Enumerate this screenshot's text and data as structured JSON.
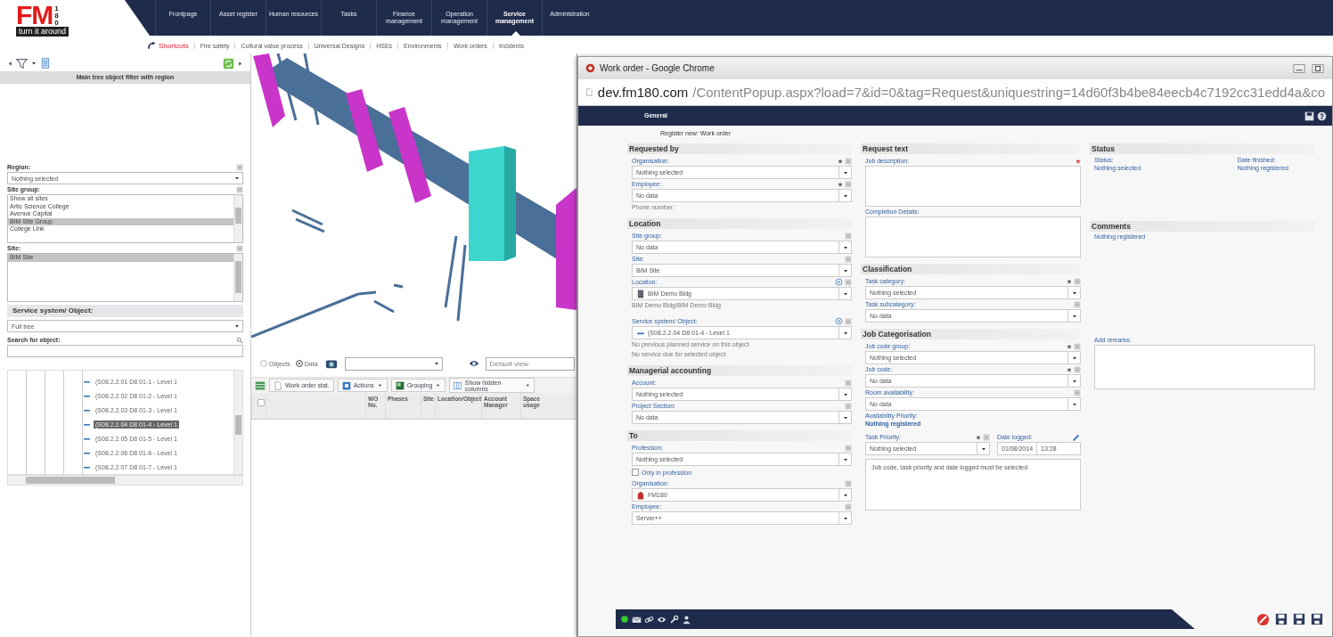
{
  "header": {
    "logo": {
      "letters": "FM",
      "number": "180",
      "tagline": "turn it around"
    },
    "nav": [
      {
        "label": "Frontpage",
        "selected": false
      },
      {
        "label": "Asset register",
        "selected": false
      },
      {
        "label": "Human resources",
        "selected": false
      },
      {
        "label": "Tasks",
        "selected": false
      },
      {
        "label": "Finance management",
        "selected": false
      },
      {
        "label": "Operation management",
        "selected": false
      },
      {
        "label": "Service management",
        "selected": true
      },
      {
        "label": "Administration",
        "selected": false
      }
    ]
  },
  "shortcuts": {
    "label": "Shortcuts",
    "items": [
      "Fire safety",
      "Cultural value process",
      "Universal Designs",
      "HSEs",
      "Environments",
      "Work orders",
      "Incidents"
    ]
  },
  "left_panel": {
    "title": "Main tree object filter with region",
    "filters": [
      {
        "kind": "select",
        "label": "Region:",
        "value": "Nothing selected"
      },
      {
        "kind": "list",
        "label": "Site group:",
        "options": [
          {
            "label": "Show all sites",
            "selected": false
          },
          {
            "label": "Artic Science College",
            "selected": false
          },
          {
            "label": "Avenue Capital",
            "selected": false
          },
          {
            "label": "BIM Site Group",
            "selected": true
          },
          {
            "label": "College Link",
            "selected": false
          }
        ]
      },
      {
        "kind": "list",
        "label": "Site:",
        "options": [
          {
            "label": "BIM Site",
            "selected": true
          }
        ]
      }
    ],
    "object_section": {
      "title": "Service system/ Object:",
      "value": "Full tree",
      "search_label": "Search for object:"
    },
    "tree": [
      {
        "label": "(S08.2.2.01 D8 01-1 - Level 1",
        "selected": false
      },
      {
        "label": "(S08.2.2.02 D8 01-2 - Level 1",
        "selected": false
      },
      {
        "label": "(S08.2.2.03 D8 01-3 - Level 1",
        "selected": false
      },
      {
        "label": "(S08.2.2.04 D8 01-4 - Level 1",
        "selected": true
      },
      {
        "label": "(S08.2.2.05 D8 01-5 - Level 1",
        "selected": false
      },
      {
        "label": "(S08.2.2.06 D8 01-6 - Level 1",
        "selected": false
      },
      {
        "label": "(S08.2.2.07 D8 01-7 - Level 1",
        "selected": false
      }
    ]
  },
  "view": {
    "kind": "picture",
    "modes": [
      {
        "label": "Objects",
        "selected": false
      },
      {
        "label": "Data",
        "selected": true
      }
    ],
    "view_name": "Default view"
  },
  "grid": {
    "toolbar": [
      {
        "kind": "plain",
        "label": "Work order stat."
      },
      {
        "kind": "menu",
        "label": "Actions"
      },
      {
        "kind": "menu",
        "label": "Grouping"
      },
      {
        "kind": "menu",
        "label": "Show hidden columns"
      }
    ],
    "all_checked": false,
    "columns": [
      "",
      "WO No.",
      "Phases",
      "Site",
      "Location/Object",
      "Account Manager",
      "Space usage"
    ]
  },
  "popup": {
    "title": "Work order - Google Chrome",
    "url_host": "dev.fm180.com",
    "url_path": "/ContentPopup.aspx?load=7&id=0&tag=Request&uniquestring=14d60f3b4be84eecb4c7192cc31edd4a&co",
    "tab": "General",
    "heading": "Register new: Work order",
    "columns": [
      [
        {
          "title": "Requested by",
          "fields": [
            {
              "kind": "select",
              "label": "Organisation:",
              "value": "Nothing selected",
              "required": true
            },
            {
              "kind": "select",
              "label": "Employee:",
              "value": "No data",
              "required": true
            },
            {
              "kind": "note",
              "text": "Phone number:"
            }
          ]
        },
        {
          "title": "Location",
          "fields": [
            {
              "kind": "select",
              "label": "Site group:",
              "value": "No data",
              "required": false
            },
            {
              "kind": "select",
              "label": "Site:",
              "value": "BIM Site",
              "required": false
            },
            {
              "kind": "select",
              "label": "Location:",
              "value": "BIM Demo Bldg",
              "required": false,
              "locate": true
            },
            {
              "kind": "note",
              "text": "BIM Demo Bldg/BIM Demo Bldg"
            }
          ]
        },
        {
          "fields": [
            {
              "kind": "select",
              "label": "Service system/ Object:",
              "value": "(S08.2.2.04 D8 01-4 - Level 1",
              "required": false,
              "locate": true
            },
            {
              "kind": "note",
              "text": "No previous planned service on this object"
            },
            {
              "kind": "note",
              "text": "No service due for selected object"
            }
          ]
        },
        {
          "title": "Managerial accounting",
          "fields": [
            {
              "kind": "select",
              "label": "Account:",
              "value": "Nothing selected",
              "required": false
            },
            {
              "kind": "select",
              "label": "Project Section:",
              "value": "No data",
              "required": false
            }
          ]
        },
        {
          "title": "To",
          "fields": [
            {
              "kind": "select",
              "label": "Profession:",
              "value": "Nothing selected",
              "required": false
            },
            {
              "kind": "checkbox",
              "label": "Only in profession",
              "checked": false
            },
            {
              "kind": "select",
              "label": "Organisation:",
              "value": "FM180",
              "required": false
            },
            {
              "kind": "select",
              "label": "Employee:",
              "value": "Server++",
              "required": false
            }
          ]
        }
      ],
      [
        {
          "title": "Request text",
          "fields": [
            {
              "kind": "textarea",
              "label": "Job description:",
              "required": true
            },
            {
              "kind": "textarea",
              "label": "Completion Details:",
              "required": false
            }
          ]
        },
        {
          "title": "Classification",
          "fields": [
            {
              "kind": "select",
              "label": "Task category:",
              "value": "Nothing selected",
              "required": true
            },
            {
              "kind": "select",
              "label": "Task subcategory:",
              "value": "No data",
              "required": false
            }
          ]
        },
        {
          "title": "Job Categorisation",
          "fields": [
            {
              "kind": "select",
              "label": "Job code group:",
              "value": "Nothing selected",
              "required": true
            },
            {
              "kind": "select",
              "label": "Job code:",
              "value": "No data",
              "required": true
            },
            {
              "kind": "select",
              "label": "Room availability:",
              "value": "No data",
              "required": false
            },
            {
              "kind": "info",
              "label": "Availability Priority:",
              "value": "Nothing registered"
            },
            {
              "kind": "priority_date",
              "label": "Task Priority:",
              "value": "Nothing selected",
              "required": true,
              "date_label": "Date logged:",
              "date": "01/08/2014",
              "time": "13:28"
            },
            {
              "kind": "message",
              "text": "Job code, task priority and date logged must be selected"
            }
          ]
        }
      ],
      [
        {
          "title": "Status",
          "fields": [
            {
              "kind": "info_pair",
              "items": [
                {
                  "label": "Status:",
                  "value": "Nothing selected"
                },
                {
                  "label": "Date finished:",
                  "value": "Nothing registered"
                }
              ]
            }
          ]
        },
        {
          "title": "Comments",
          "fields": [
            {
              "kind": "value",
              "text": "Nothing registered"
            }
          ]
        },
        {
          "fields": [
            {
              "kind": "textarea",
              "label": "Add remarks:",
              "required": false
            }
          ]
        }
      ]
    ]
  }
}
